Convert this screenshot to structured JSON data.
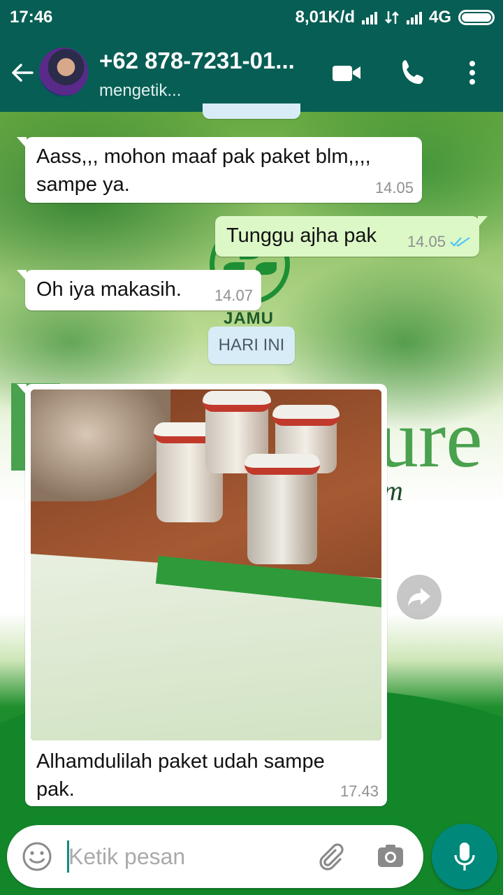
{
  "status_bar": {
    "time": "17:46",
    "network_speed": "8,01K/d",
    "network_type": "4G",
    "icons": [
      "signal-icon",
      "data-transfer-icon",
      "signal-icon",
      "battery-icon"
    ]
  },
  "header": {
    "contact_name": "+62 878-7231-01...",
    "status": "mengetik...",
    "icons": [
      "back-arrow-icon",
      "avatar",
      "video-call-icon",
      "phone-call-icon",
      "more-vert-icon"
    ]
  },
  "messages": [
    {
      "direction": "incoming",
      "text_line1": "Aass,,,  mohon maaf pak paket blm,,,,",
      "text_line2": "sampe ya.",
      "time": "14.05"
    },
    {
      "direction": "outgoing",
      "text": "Tunggu ajha pak",
      "time": "14.05",
      "status": "read"
    },
    {
      "direction": "incoming",
      "text": "Oh iya makasih.",
      "time": "14.07"
    },
    {
      "type": "date_divider",
      "text": "HARI INI"
    },
    {
      "direction": "incoming",
      "type": "image",
      "caption_line1": "Alhamdulilah paket udah sampe",
      "caption_line2": "pak.",
      "time": "17.43",
      "image_subject": "jars of herbal products on a wooden table with a product brochure"
    }
  ],
  "wallpaper_text": {
    "logo_word": "JAMU",
    "brand_fragment": "ure",
    "script_fragment": "m"
  },
  "composer": {
    "placeholder": "Ketik pesan",
    "value": "",
    "icons": [
      "emoji-icon",
      "attach-icon",
      "camera-icon",
      "mic-icon"
    ]
  },
  "colors": {
    "header": "#075e54",
    "outgoing_bubble": "#dcf8c6",
    "incoming_bubble": "#ffffff",
    "read_ticks": "#4fc3f7",
    "mic_button": "#00897b",
    "date_chip": "#d7ecf7"
  }
}
